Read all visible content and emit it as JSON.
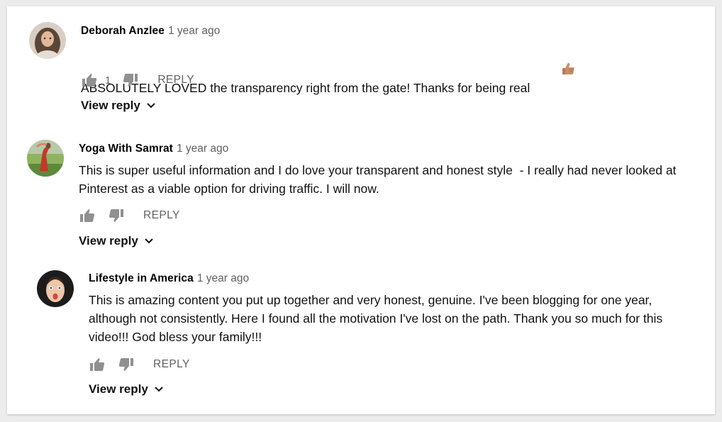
{
  "comments": [
    {
      "author": "Deborah Anzlee",
      "time": "1 year ago",
      "text": "ABSOLUTELY LOVED the transparency right from the gate! Thanks for being real",
      "emoji_icon": "thumbs-up-emoji-icon",
      "likes": "1",
      "reply_label": "REPLY",
      "view_reply_label": "View reply"
    },
    {
      "author": "Yoga With Samrat",
      "time": "1 year ago",
      "text": "This is super useful information and I do love your transparent and honest style  - I really had never looked at Pinterest as a viable option for driving traffic. I will now.",
      "reply_label": "REPLY",
      "view_reply_label": "View reply"
    },
    {
      "author": "Lifestyle in America",
      "time": "1 year ago",
      "text": "This is amazing content you put up together and very honest, genuine. I've been blogging for one year, although not consistently. Here I found all the motivation I've lost on the path. Thank you so much for this video!!! God bless your family!!!",
      "reply_label": "REPLY",
      "view_reply_label": "View reply"
    }
  ],
  "colors": {
    "secondary_text": "#606060",
    "icon": "#909090",
    "background": "#ececec"
  }
}
